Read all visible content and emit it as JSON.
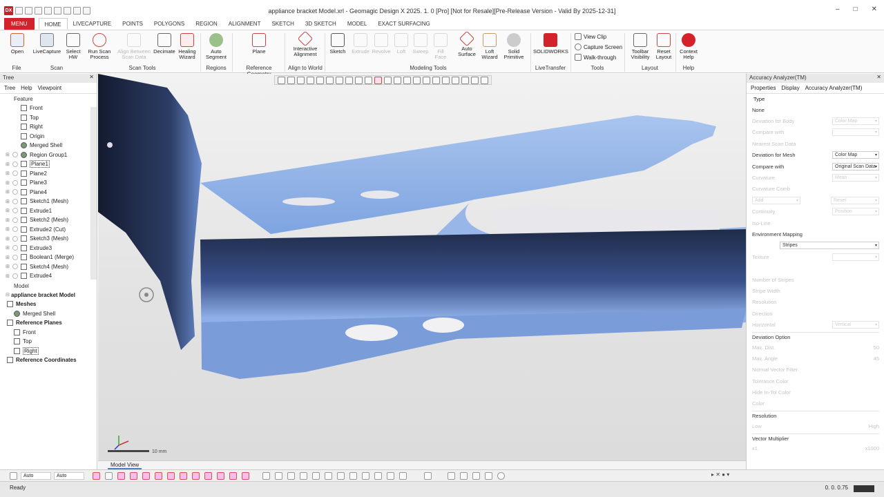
{
  "window": {
    "title": "appliance bracket Model.xrl - Geomagic Design X 2025. 1. 0 [Pro] [Not for Resale][Pre-Release Version - Valid By 2025-12-31]",
    "logo": "DX"
  },
  "tabs": [
    "MENU",
    "HOME",
    "LIVECAPTURE",
    "POINTS",
    "POLYGONS",
    "REGION",
    "ALIGNMENT",
    "SKETCH",
    "3D SKETCH",
    "MODEL",
    "EXACT SURFACING"
  ],
  "ribbon": {
    "buttons": [
      {
        "label": "Open",
        "icon": "open-icon"
      },
      {
        "label": "LiveCapture",
        "icon": "livecapture-icon"
      },
      {
        "label": "Select\nHW",
        "icon": "select-hw-icon"
      },
      {
        "label": "Run Scan\nProcess",
        "icon": "run-scan-process-icon"
      },
      {
        "label": "Align Between\nScan Data",
        "icon": "align-between-scan-icon"
      },
      {
        "label": "Decimate",
        "icon": "decimate-icon"
      },
      {
        "label": "Healing\nWizard",
        "icon": "healing-wizard-icon"
      },
      {
        "label": "Auto\nSegment",
        "icon": "auto-segment-icon"
      },
      {
        "label": "Plane",
        "icon": "plane-icon"
      },
      {
        "label": "Interactive\nAlignment",
        "icon": "interactive-alignment-icon"
      },
      {
        "label": "Sketch",
        "icon": "sketch-icon"
      },
      {
        "label": "Extrude",
        "icon": "extrude-icon"
      },
      {
        "label": "Revolve",
        "icon": "revolve-icon"
      },
      {
        "label": "Loft",
        "icon": "loft-icon"
      },
      {
        "label": "Sweep",
        "icon": "sweep-icon"
      },
      {
        "label": "Fill\nFace",
        "icon": "fill-face-icon"
      },
      {
        "label": "Auto\nSurface",
        "icon": "auto-surface-icon"
      },
      {
        "label": "Loft\nWizard",
        "icon": "loft-wizard-icon"
      },
      {
        "label": "Solid\nPrimitive",
        "icon": "solid-primitive-icon"
      },
      {
        "label": "SOLIDWORKS",
        "icon": "solidworks-icon"
      },
      {
        "label": "Toolbar\nVisibility",
        "icon": "toolbar-visibility-icon"
      },
      {
        "label": "Reset\nLayout",
        "icon": "reset-layout-icon"
      },
      {
        "label": "Context\nHelp",
        "icon": "context-help-icon"
      }
    ],
    "small_buttons": [
      "View Clip",
      "Capture Screen",
      "Walk-through"
    ],
    "groups": [
      "File",
      "Scan",
      "Scan Tools",
      "Regions",
      "Reference Geometry",
      "Align to World",
      "Modeling Tools",
      "LiveTransfer",
      "Tools",
      "Layout",
      "Help"
    ]
  },
  "tree": {
    "panel_title": "Tree",
    "tabs": [
      "Tree",
      "Help",
      "Viewpoint"
    ],
    "feature_heading": "Feature",
    "features": [
      "Front",
      "Top",
      "Right",
      "Origin",
      "Merged Shell",
      "Region Group1",
      "Plane1",
      "Plane2",
      "Plane3",
      "Plane4",
      "Sketch1 (Mesh)",
      "Extrude1",
      "Sketch2 (Mesh)",
      "Extrude2 (Cut)",
      "Sketch3 (Mesh)",
      "Extrude3",
      "Boolean1 (Merge)",
      "Sketch4 (Mesh)",
      "Extrude4"
    ],
    "model_heading": "Model",
    "model_root": "appliance bracket Model",
    "model_items": [
      "Meshes",
      "Merged Shell",
      "Reference Planes",
      "Front",
      "Top",
      "Right",
      "Reference Coordinates"
    ]
  },
  "viewport": {
    "scale_label": "10 mm",
    "view_tab": "Model View"
  },
  "accuracy": {
    "panel_title": "Accuracy Analyzer(TM)",
    "tabs": [
      "Properties",
      "Display",
      "Accuracy Analyzer(TM)"
    ],
    "type_heading": "Type",
    "rows": [
      {
        "label": "None",
        "value": "",
        "enabled": true
      },
      {
        "label": "Deviation for Body",
        "value": "Color Map",
        "enabled": false
      },
      {
        "label": "Compare with",
        "value": "",
        "enabled": false
      },
      {
        "label": "Nearest Scan Data",
        "value": "",
        "enabled": false
      },
      {
        "label": "Deviation for Mesh",
        "value": "Color Map",
        "enabled": true
      },
      {
        "label": "Compare with",
        "value": "Original Scan Data",
        "enabled": true
      },
      {
        "label": "Curvature",
        "value": "Mean",
        "enabled": false
      },
      {
        "label": "Curvature Comb",
        "value": "",
        "enabled": false
      },
      {
        "label": "",
        "value": "",
        "enabled": false
      },
      {
        "label": "Continuity",
        "value": "Position",
        "enabled": false
      },
      {
        "label": "Iso-Line",
        "value": "",
        "enabled": false
      },
      {
        "label": "Environment Mapping",
        "value": "",
        "enabled": true
      },
      {
        "label": "",
        "value": "Stripes",
        "enabled": true
      },
      {
        "label": "Texture",
        "value": "",
        "enabled": false
      },
      {
        "label": "",
        "value": "",
        "enabled": false
      },
      {
        "label": "Number of Stripes",
        "value": "",
        "enabled": false
      },
      {
        "label": "Stripe Width",
        "value": "",
        "enabled": false
      },
      {
        "label": "Resolution",
        "value": "",
        "enabled": false
      },
      {
        "label": "Direction",
        "value": "",
        "enabled": false
      },
      {
        "label": "Horizontal",
        "value": "Vertical",
        "enabled": false
      }
    ],
    "buttons": [
      "Add",
      "Reset"
    ],
    "deviation_heading": "Deviation Option",
    "deviation_rows": [
      {
        "label": "Max. Dist.",
        "value": "50"
      },
      {
        "label": "Max. Angle",
        "value": "45"
      },
      {
        "label": "Normal Vector Filter",
        "value": ""
      },
      {
        "label": "Tolerance Color",
        "value": ""
      },
      {
        "label": "Hide In-Tol Color",
        "value": ""
      },
      {
        "label": "Color",
        "value": ""
      }
    ],
    "resolution_heading": "Resolution",
    "res_low": "Low",
    "res_high": "High",
    "vector_heading": "Vector Multiplier",
    "vec_low": "x1",
    "vec_high": "x1000"
  },
  "bottom": {
    "select1": "Auto",
    "select2": "Auto"
  },
  "status": {
    "left": "Ready",
    "right": "0. 0. 0.75"
  },
  "colors": {
    "accent": "#d4222a",
    "mesh": "#8aaee8",
    "mesh_shadow": "#2b3a5e"
  }
}
